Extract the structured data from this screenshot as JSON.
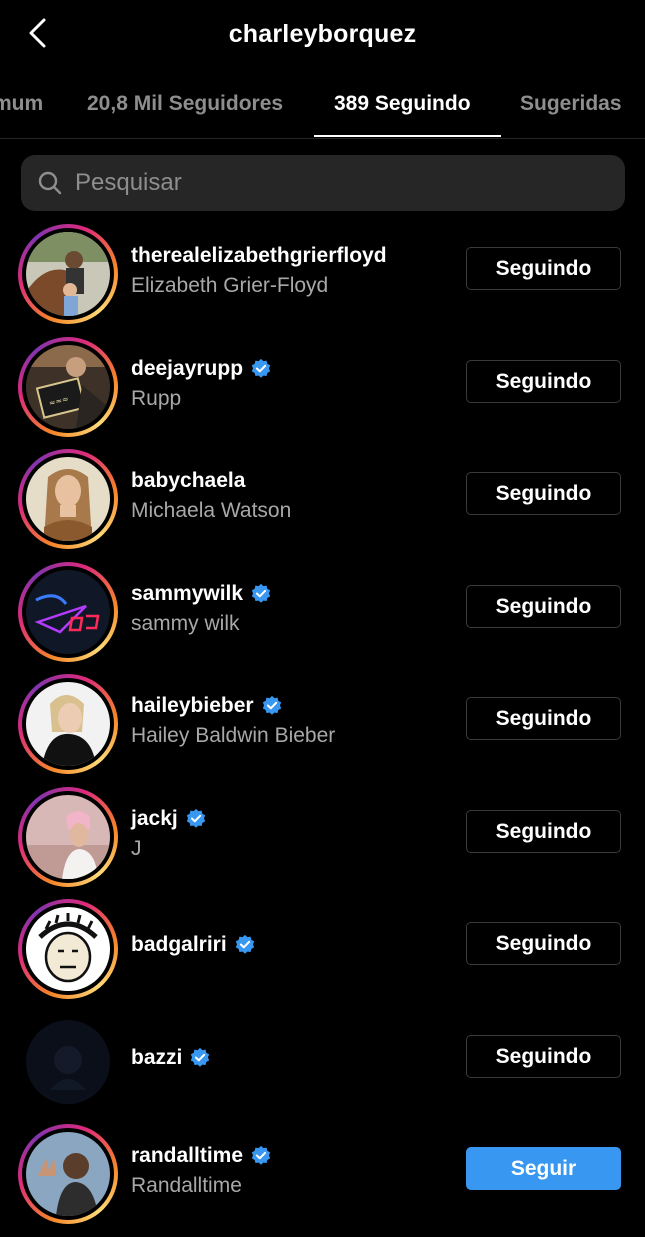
{
  "header": {
    "title": "charleyborquez",
    "back_icon": "chevron-left-icon"
  },
  "tabs": [
    {
      "label": "mum",
      "active": false
    },
    {
      "label": "20,8 Mil Seguidores",
      "active": false
    },
    {
      "label": "389 Seguindo",
      "active": true
    },
    {
      "label": "Sugeridas",
      "active": false
    }
  ],
  "search": {
    "placeholder": "Pesquisar",
    "value": "",
    "icon": "search-icon"
  },
  "colors": {
    "background": "#000000",
    "search_bg": "#262626",
    "secondary_text": "#a8a8a8",
    "inactive_tab": "#8e8e8e",
    "verified_blue": "#3897f0",
    "follow_blue": "#3897f0",
    "button_border": "#3a3a3a"
  },
  "following": [
    {
      "username": "therealelizabethgrierfloyd",
      "full_name": "Elizabeth Grier-Floyd",
      "verified": false,
      "has_story_ring": true,
      "button_label": "Seguindo",
      "avatar": "woman-with-horse-and-child-photo"
    },
    {
      "username": "deejayrupp",
      "full_name": "Rupp",
      "verified": true,
      "has_story_ring": true,
      "button_label": "Seguindo",
      "avatar": "man-holding-plaque-photo"
    },
    {
      "username": "babychaela",
      "full_name": "Michaela Watson",
      "verified": false,
      "has_story_ring": true,
      "button_label": "Seguindo",
      "avatar": "woman-portrait-photo"
    },
    {
      "username": "sammywilk",
      "full_name": "sammy wilk",
      "verified": true,
      "has_story_ring": true,
      "button_label": "Seguindo",
      "avatar": "free-up-neon-logo"
    },
    {
      "username": "haileybieber",
      "full_name": "Hailey Baldwin Bieber",
      "verified": true,
      "has_story_ring": true,
      "button_label": "Seguindo",
      "avatar": "blonde-woman-black-outfit-photo"
    },
    {
      "username": "jackj",
      "full_name": "J",
      "verified": true,
      "has_story_ring": true,
      "button_label": "Seguindo",
      "avatar": "pink-hair-man-sunset-photo"
    },
    {
      "username": "badgalriri",
      "full_name": "",
      "verified": true,
      "has_story_ring": true,
      "button_label": "Seguindo",
      "avatar": "cartoon-face-drawing"
    },
    {
      "username": "bazzi",
      "full_name": "",
      "verified": true,
      "has_story_ring": false,
      "button_label": "Seguindo",
      "avatar": "dark-night-photo"
    },
    {
      "username": "randalltime",
      "full_name": "Randalltime",
      "verified": true,
      "has_story_ring": true,
      "button_label": "Seguir",
      "avatar": "man-peace-sign-photo"
    }
  ]
}
